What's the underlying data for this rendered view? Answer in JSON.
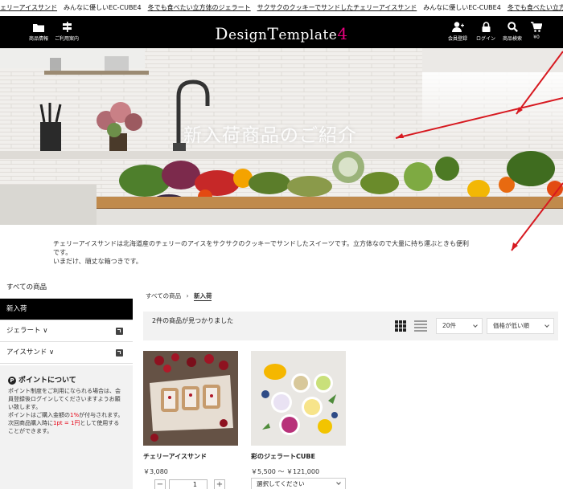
{
  "ticker": {
    "items": [
      {
        "text": "ェリーアイスサンド",
        "u": true
      },
      {
        "text": "みんなに優しいEC-CUBE4",
        "u": false
      },
      {
        "text": "冬でも食べたい立方体のジェラート",
        "u": true
      },
      {
        "text": "サクサクのクッキーでサンドしたチェリーアイスサンド",
        "u": true
      },
      {
        "text": "みんなに優しいEC-CUBE4",
        "u": false
      },
      {
        "text": "冬でも食べたい立方体のジェラート",
        "u": true
      }
    ]
  },
  "header": {
    "left_buttons": [
      {
        "icon": "folder-icon",
        "label": "商品情報"
      },
      {
        "icon": "signpost-icon",
        "label": "ご利用案内"
      }
    ],
    "logo": {
      "part1": "D",
      "part2": "esign",
      "part3": "T",
      "part4": "emplate",
      "num": "4"
    },
    "right_buttons": [
      {
        "icon": "user-plus-icon",
        "label": "会員登録"
      },
      {
        "icon": "lock-icon",
        "label": "ログイン"
      },
      {
        "icon": "search-icon",
        "label": "商品検索"
      },
      {
        "icon": "cart-icon",
        "label": "¥0"
      }
    ]
  },
  "hero": {
    "title": "新入荷商品のご紹介"
  },
  "description": {
    "line1": "チェリーアイスサンドは北海道産のチェリーのアイスをサクサクのクッキーでサンドしたスイーツです。立方体なので大量に持ち運ぶときも便利",
    "line2": "です。",
    "line3": "いまだけ、頑丈な箱つきです。"
  },
  "sidebar": {
    "items": [
      {
        "label": "すべての商品",
        "active": false,
        "plus": false
      },
      {
        "label": "新入荷",
        "active": true,
        "plus": false
      },
      {
        "label": "ジェラート ∨",
        "active": false,
        "plus": true
      },
      {
        "label": "アイスサンド ∨",
        "active": false,
        "plus": true
      }
    ],
    "points": {
      "badge": "P",
      "title": "ポイントについて",
      "text1": "ポイント制度をご利用になられる場合は、会員登録後ログインしてくださいますようお願い致します。",
      "text2a": "ポイントはご購入金額の",
      "text2b": "1%",
      "text2c": "が付与されます。",
      "text3a": "次回商品購入時に",
      "text3b": "1pt = 1円",
      "text3c": "として使用することができます。"
    }
  },
  "breadcrumb": {
    "root": "すべての商品",
    "sep": "›",
    "current": "新入荷"
  },
  "listing": {
    "found": "2件の商品が見つかりました",
    "per_page": "20件",
    "sort": "価格が低い順"
  },
  "products": [
    {
      "name": "チェリーアイスサンド",
      "price": "￥3,080",
      "qty": "1"
    },
    {
      "name": "彩のジェラートCUBE",
      "price": "￥5,500 ～ ￥121,000",
      "option": "選択してください"
    }
  ],
  "colors": {
    "accent": "#e5007e",
    "header_bg": "#000000",
    "annotation_arrow": "#d71920"
  }
}
